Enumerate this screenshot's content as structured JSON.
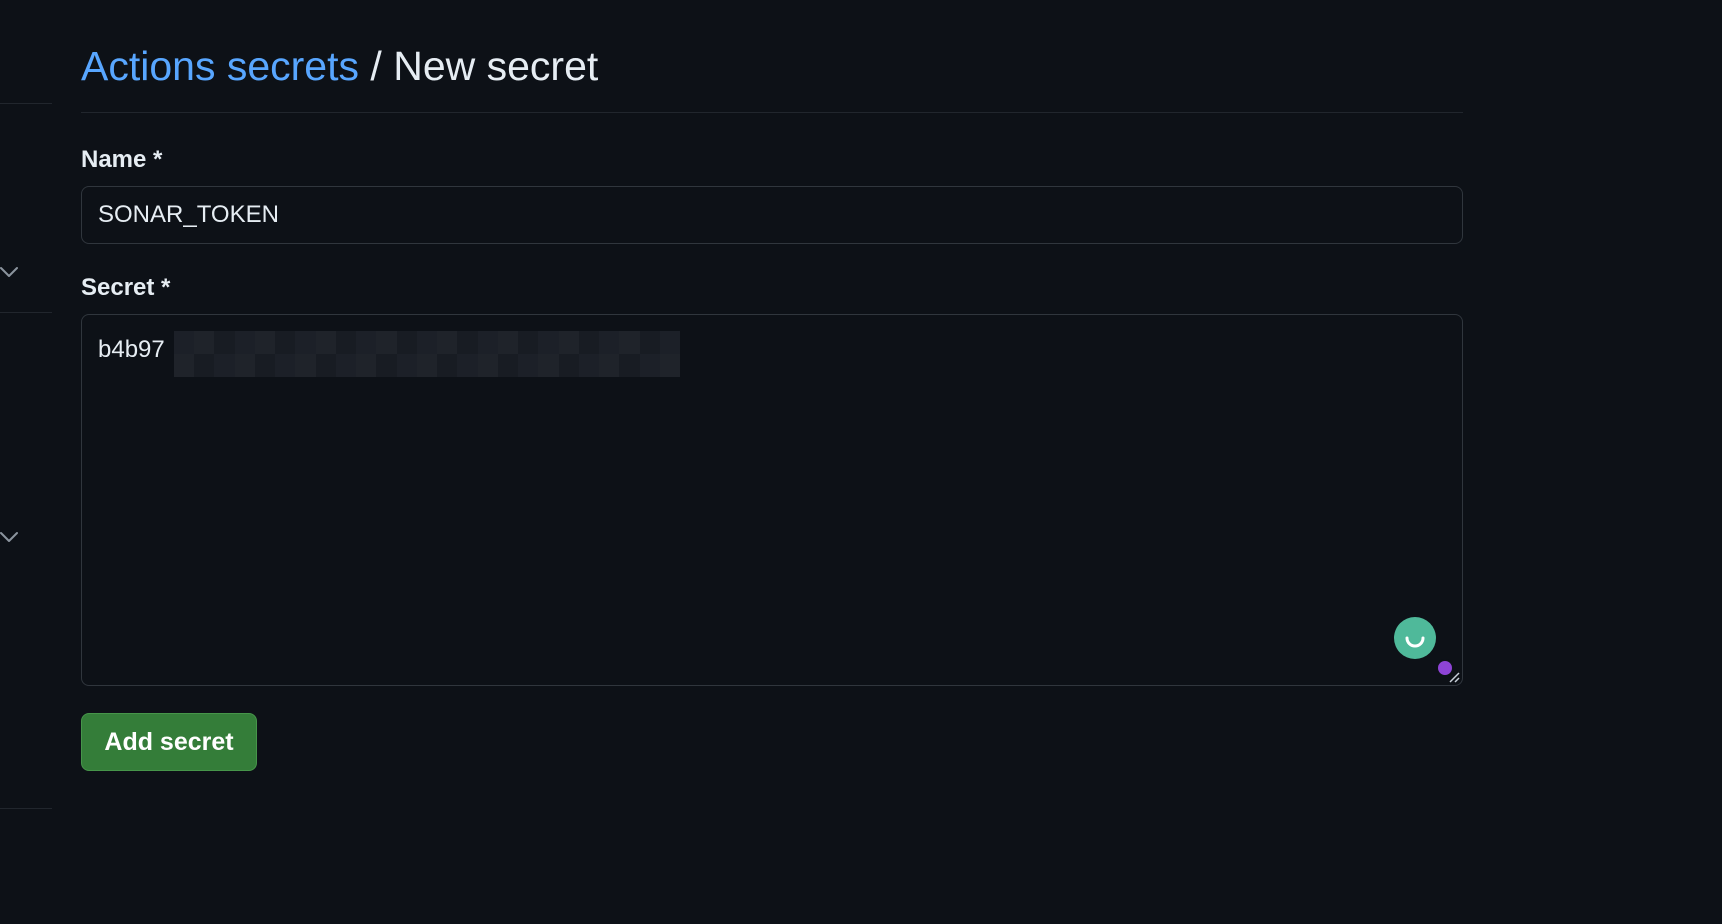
{
  "breadcrumb": {
    "parent_label": "Actions secrets",
    "separator": "/",
    "current_label": "New secret"
  },
  "form": {
    "name_label": "Name *",
    "name_value": "SONAR_TOKEN",
    "secret_label": "Secret *",
    "secret_visible_prefix": "b4b97",
    "submit_label": "Add secret"
  },
  "colors": {
    "background": "#0d1117",
    "link": "#58a6ff",
    "button": "#347d39",
    "assistant_bubble": "#4fb99a",
    "assistant_dot": "#8e44d6"
  },
  "icons": {
    "sidebar_chevrons": [
      "chevron-down-icon",
      "chevron-down-icon"
    ],
    "assistant": "grammar-assistant-icon",
    "resize": "resize-grip-icon"
  }
}
